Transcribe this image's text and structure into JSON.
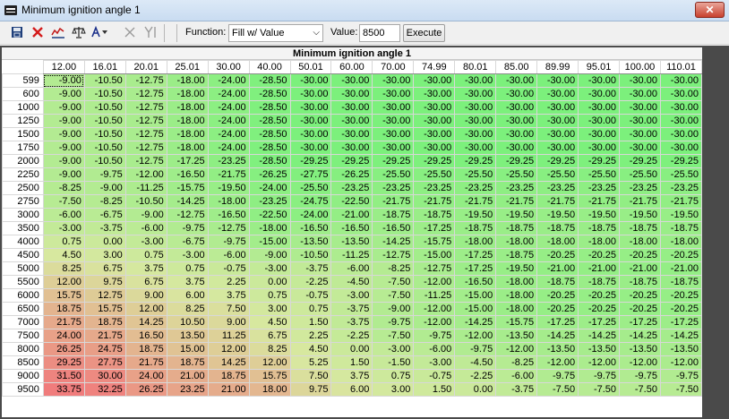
{
  "window": {
    "title": "Minimum ignition angle 1",
    "close_glyph": "✕"
  },
  "toolbar": {
    "function_label": "Function:",
    "function_value": "Fill w/ Value",
    "value_label": "Value:",
    "value_input": "8500",
    "execute_label": "Execute"
  },
  "grid": {
    "title": "Minimum ignition angle 1",
    "columns": [
      "12.00",
      "16.01",
      "20.01",
      "25.01",
      "30.00",
      "40.00",
      "50.01",
      "60.00",
      "70.00",
      "74.99",
      "80.01",
      "85.00",
      "89.99",
      "95.01",
      "100.00",
      "110.01"
    ],
    "rows": [
      {
        "rpm": "599",
        "cells": [
          "-9.00",
          "-10.50",
          "-12.75",
          "-18.00",
          "-24.00",
          "-28.50",
          "-30.00",
          "-30.00",
          "-30.00",
          "-30.00",
          "-30.00",
          "-30.00",
          "-30.00",
          "-30.00",
          "-30.00",
          "-30.00"
        ]
      },
      {
        "rpm": "600",
        "cells": [
          "-9.00",
          "-10.50",
          "-12.75",
          "-18.00",
          "-24.00",
          "-28.50",
          "-30.00",
          "-30.00",
          "-30.00",
          "-30.00",
          "-30.00",
          "-30.00",
          "-30.00",
          "-30.00",
          "-30.00",
          "-30.00"
        ]
      },
      {
        "rpm": "1000",
        "cells": [
          "-9.00",
          "-10.50",
          "-12.75",
          "-18.00",
          "-24.00",
          "-28.50",
          "-30.00",
          "-30.00",
          "-30.00",
          "-30.00",
          "-30.00",
          "-30.00",
          "-30.00",
          "-30.00",
          "-30.00",
          "-30.00"
        ]
      },
      {
        "rpm": "1250",
        "cells": [
          "-9.00",
          "-10.50",
          "-12.75",
          "-18.00",
          "-24.00",
          "-28.50",
          "-30.00",
          "-30.00",
          "-30.00",
          "-30.00",
          "-30.00",
          "-30.00",
          "-30.00",
          "-30.00",
          "-30.00",
          "-30.00"
        ]
      },
      {
        "rpm": "1500",
        "cells": [
          "-9.00",
          "-10.50",
          "-12.75",
          "-18.00",
          "-24.00",
          "-28.50",
          "-30.00",
          "-30.00",
          "-30.00",
          "-30.00",
          "-30.00",
          "-30.00",
          "-30.00",
          "-30.00",
          "-30.00",
          "-30.00"
        ]
      },
      {
        "rpm": "1750",
        "cells": [
          "-9.00",
          "-10.50",
          "-12.75",
          "-18.00",
          "-24.00",
          "-28.50",
          "-30.00",
          "-30.00",
          "-30.00",
          "-30.00",
          "-30.00",
          "-30.00",
          "-30.00",
          "-30.00",
          "-30.00",
          "-30.00"
        ]
      },
      {
        "rpm": "2000",
        "cells": [
          "-9.00",
          "-10.50",
          "-12.75",
          "-17.25",
          "-23.25",
          "-28.50",
          "-29.25",
          "-29.25",
          "-29.25",
          "-29.25",
          "-29.25",
          "-29.25",
          "-29.25",
          "-29.25",
          "-29.25",
          "-29.25"
        ]
      },
      {
        "rpm": "2250",
        "cells": [
          "-9.00",
          "-9.75",
          "-12.00",
          "-16.50",
          "-21.75",
          "-26.25",
          "-27.75",
          "-26.25",
          "-25.50",
          "-25.50",
          "-25.50",
          "-25.50",
          "-25.50",
          "-25.50",
          "-25.50",
          "-25.50"
        ]
      },
      {
        "rpm": "2500",
        "cells": [
          "-8.25",
          "-9.00",
          "-11.25",
          "-15.75",
          "-19.50",
          "-24.00",
          "-25.50",
          "-23.25",
          "-23.25",
          "-23.25",
          "-23.25",
          "-23.25",
          "-23.25",
          "-23.25",
          "-23.25",
          "-23.25"
        ]
      },
      {
        "rpm": "2750",
        "cells": [
          "-7.50",
          "-8.25",
          "-10.50",
          "-14.25",
          "-18.00",
          "-23.25",
          "-24.75",
          "-22.50",
          "-21.75",
          "-21.75",
          "-21.75",
          "-21.75",
          "-21.75",
          "-21.75",
          "-21.75",
          "-21.75"
        ]
      },
      {
        "rpm": "3000",
        "cells": [
          "-6.00",
          "-6.75",
          "-9.00",
          "-12.75",
          "-16.50",
          "-22.50",
          "-24.00",
          "-21.00",
          "-18.75",
          "-18.75",
          "-19.50",
          "-19.50",
          "-19.50",
          "-19.50",
          "-19.50",
          "-19.50"
        ]
      },
      {
        "rpm": "3500",
        "cells": [
          "-3.00",
          "-3.75",
          "-6.00",
          "-9.75",
          "-12.75",
          "-18.00",
          "-16.50",
          "-16.50",
          "-16.50",
          "-17.25",
          "-18.75",
          "-18.75",
          "-18.75",
          "-18.75",
          "-18.75",
          "-18.75"
        ]
      },
      {
        "rpm": "4000",
        "cells": [
          "0.75",
          "0.00",
          "-3.00",
          "-6.75",
          "-9.75",
          "-15.00",
          "-13.50",
          "-13.50",
          "-14.25",
          "-15.75",
          "-18.00",
          "-18.00",
          "-18.00",
          "-18.00",
          "-18.00",
          "-18.00"
        ]
      },
      {
        "rpm": "4500",
        "cells": [
          "4.50",
          "3.00",
          "0.75",
          "-3.00",
          "-6.00",
          "-9.00",
          "-10.50",
          "-11.25",
          "-12.75",
          "-15.00",
          "-17.25",
          "-18.75",
          "-20.25",
          "-20.25",
          "-20.25",
          "-20.25"
        ]
      },
      {
        "rpm": "5000",
        "cells": [
          "8.25",
          "6.75",
          "3.75",
          "0.75",
          "-0.75",
          "-3.00",
          "-3.75",
          "-6.00",
          "-8.25",
          "-12.75",
          "-17.25",
          "-19.50",
          "-21.00",
          "-21.00",
          "-21.00",
          "-21.00"
        ]
      },
      {
        "rpm": "5500",
        "cells": [
          "12.00",
          "9.75",
          "6.75",
          "3.75",
          "2.25",
          "0.00",
          "-2.25",
          "-4.50",
          "-7.50",
          "-12.00",
          "-16.50",
          "-18.00",
          "-18.75",
          "-18.75",
          "-18.75",
          "-18.75"
        ]
      },
      {
        "rpm": "6000",
        "cells": [
          "15.75",
          "12.75",
          "9.00",
          "6.00",
          "3.75",
          "0.75",
          "-0.75",
          "-3.00",
          "-7.50",
          "-11.25",
          "-15.00",
          "-18.00",
          "-20.25",
          "-20.25",
          "-20.25",
          "-20.25"
        ]
      },
      {
        "rpm": "6500",
        "cells": [
          "18.75",
          "15.75",
          "12.00",
          "8.25",
          "7.50",
          "3.00",
          "0.75",
          "-3.75",
          "-9.00",
          "-12.00",
          "-15.00",
          "-18.00",
          "-20.25",
          "-20.25",
          "-20.25",
          "-20.25"
        ]
      },
      {
        "rpm": "7000",
        "cells": [
          "21.75",
          "18.75",
          "14.25",
          "10.50",
          "9.00",
          "4.50",
          "1.50",
          "-3.75",
          "-9.75",
          "-12.00",
          "-14.25",
          "-15.75",
          "-17.25",
          "-17.25",
          "-17.25",
          "-17.25"
        ]
      },
      {
        "rpm": "7500",
        "cells": [
          "24.00",
          "21.75",
          "16.50",
          "13.50",
          "11.25",
          "6.75",
          "2.25",
          "-2.25",
          "-7.50",
          "-9.75",
          "-12.00",
          "-13.50",
          "-14.25",
          "-14.25",
          "-14.25",
          "-14.25"
        ]
      },
      {
        "rpm": "8000",
        "cells": [
          "26.25",
          "24.75",
          "18.75",
          "15.00",
          "12.00",
          "8.25",
          "4.50",
          "0.00",
          "-3.00",
          "-6.00",
          "-9.75",
          "-12.00",
          "-13.50",
          "-13.50",
          "-13.50",
          "-13.50"
        ]
      },
      {
        "rpm": "8500",
        "cells": [
          "29.25",
          "27.75",
          "21.75",
          "18.75",
          "14.25",
          "12.00",
          "5.25",
          "1.50",
          "-1.50",
          "-3.00",
          "-4.50",
          "-8.25",
          "-12.00",
          "-12.00",
          "-12.00",
          "-12.00"
        ]
      },
      {
        "rpm": "9000",
        "cells": [
          "31.50",
          "30.00",
          "24.00",
          "21.00",
          "18.75",
          "15.75",
          "7.50",
          "3.75",
          "0.75",
          "-0.75",
          "-2.25",
          "-6.00",
          "-9.75",
          "-9.75",
          "-9.75",
          "-9.75"
        ]
      },
      {
        "rpm": "9500",
        "cells": [
          "33.75",
          "32.25",
          "26.25",
          "23.25",
          "21.00",
          "18.00",
          "9.75",
          "6.00",
          "3.00",
          "1.50",
          "0.00",
          "-3.75",
          "-7.50",
          "-7.50",
          "-7.50",
          "-7.50"
        ]
      }
    ]
  },
  "colors": {
    "low": "#7cf07c",
    "mid": "#d8e8a0",
    "high": "#f07c7c"
  }
}
